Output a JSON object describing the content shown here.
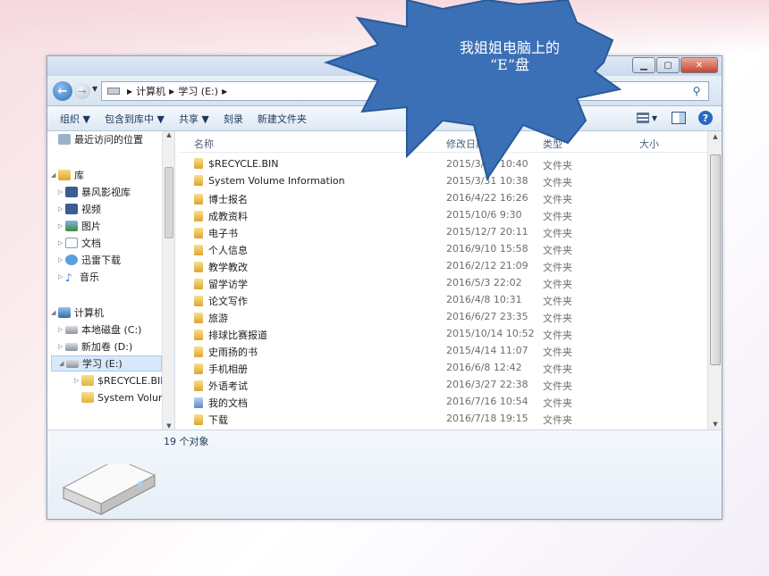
{
  "callout": {
    "line1": "我姐姐电脑上的",
    "line2": "“E”盘"
  },
  "breadcrumb": {
    "computer": "计算机",
    "drive": "学习 (E:)"
  },
  "toolbar": {
    "organize": "组织 ▼",
    "include_library": "包含到库中 ▼",
    "share": "共享 ▼",
    "burn": "刻录",
    "new_folder": "新建文件夹"
  },
  "nav": {
    "recent": "最近访问的位置",
    "libraries": "库",
    "lib_items": [
      "暴风影视库",
      "视频",
      "图片",
      "文档",
      "迅雷下载",
      "音乐"
    ],
    "computer": "计算机",
    "drives": [
      "本地磁盘 (C:)",
      "新加卷 (D:)",
      "学习 (E:)"
    ],
    "subfolders": [
      "$RECYCLE.BIN",
      "System Volum"
    ]
  },
  "columns": {
    "name": "名称",
    "date": "修改日期",
    "type": "类型",
    "size": "大小"
  },
  "files": [
    {
      "name": "$RECYCLE.BIN",
      "date": "2015/3/31 10:40",
      "type": "文件夹"
    },
    {
      "name": "System Volume Information",
      "date": "2015/3/31 10:38",
      "type": "文件夹"
    },
    {
      "name": "博士报名",
      "date": "2016/4/22 16:26",
      "type": "文件夹"
    },
    {
      "name": "成教资料",
      "date": "2015/10/6 9:30",
      "type": "文件夹"
    },
    {
      "name": "电子书",
      "date": "2015/12/7 20:11",
      "type": "文件夹"
    },
    {
      "name": "个人信息",
      "date": "2016/9/10 15:58",
      "type": "文件夹"
    },
    {
      "name": "教学教改",
      "date": "2016/2/12 21:09",
      "type": "文件夹"
    },
    {
      "name": "留学访学",
      "date": "2016/5/3 22:02",
      "type": "文件夹"
    },
    {
      "name": "论文写作",
      "date": "2016/4/8 10:31",
      "type": "文件夹"
    },
    {
      "name": "旅游",
      "date": "2016/6/27 23:35",
      "type": "文件夹"
    },
    {
      "name": "排球比赛报道",
      "date": "2015/10/14 10:52",
      "type": "文件夹"
    },
    {
      "name": "史雨扬的书",
      "date": "2015/4/14 11:07",
      "type": "文件夹"
    },
    {
      "name": "手机相册",
      "date": "2016/6/8 12:42",
      "type": "文件夹"
    },
    {
      "name": "外语考试",
      "date": "2016/3/27 22:38",
      "type": "文件夹"
    },
    {
      "name": "我的文档",
      "date": "2016/7/16 10:54",
      "type": "文件夹"
    },
    {
      "name": "下载",
      "date": "2016/7/18 19:15",
      "type": "文件夹"
    }
  ],
  "status": {
    "count": "19 个对象"
  }
}
